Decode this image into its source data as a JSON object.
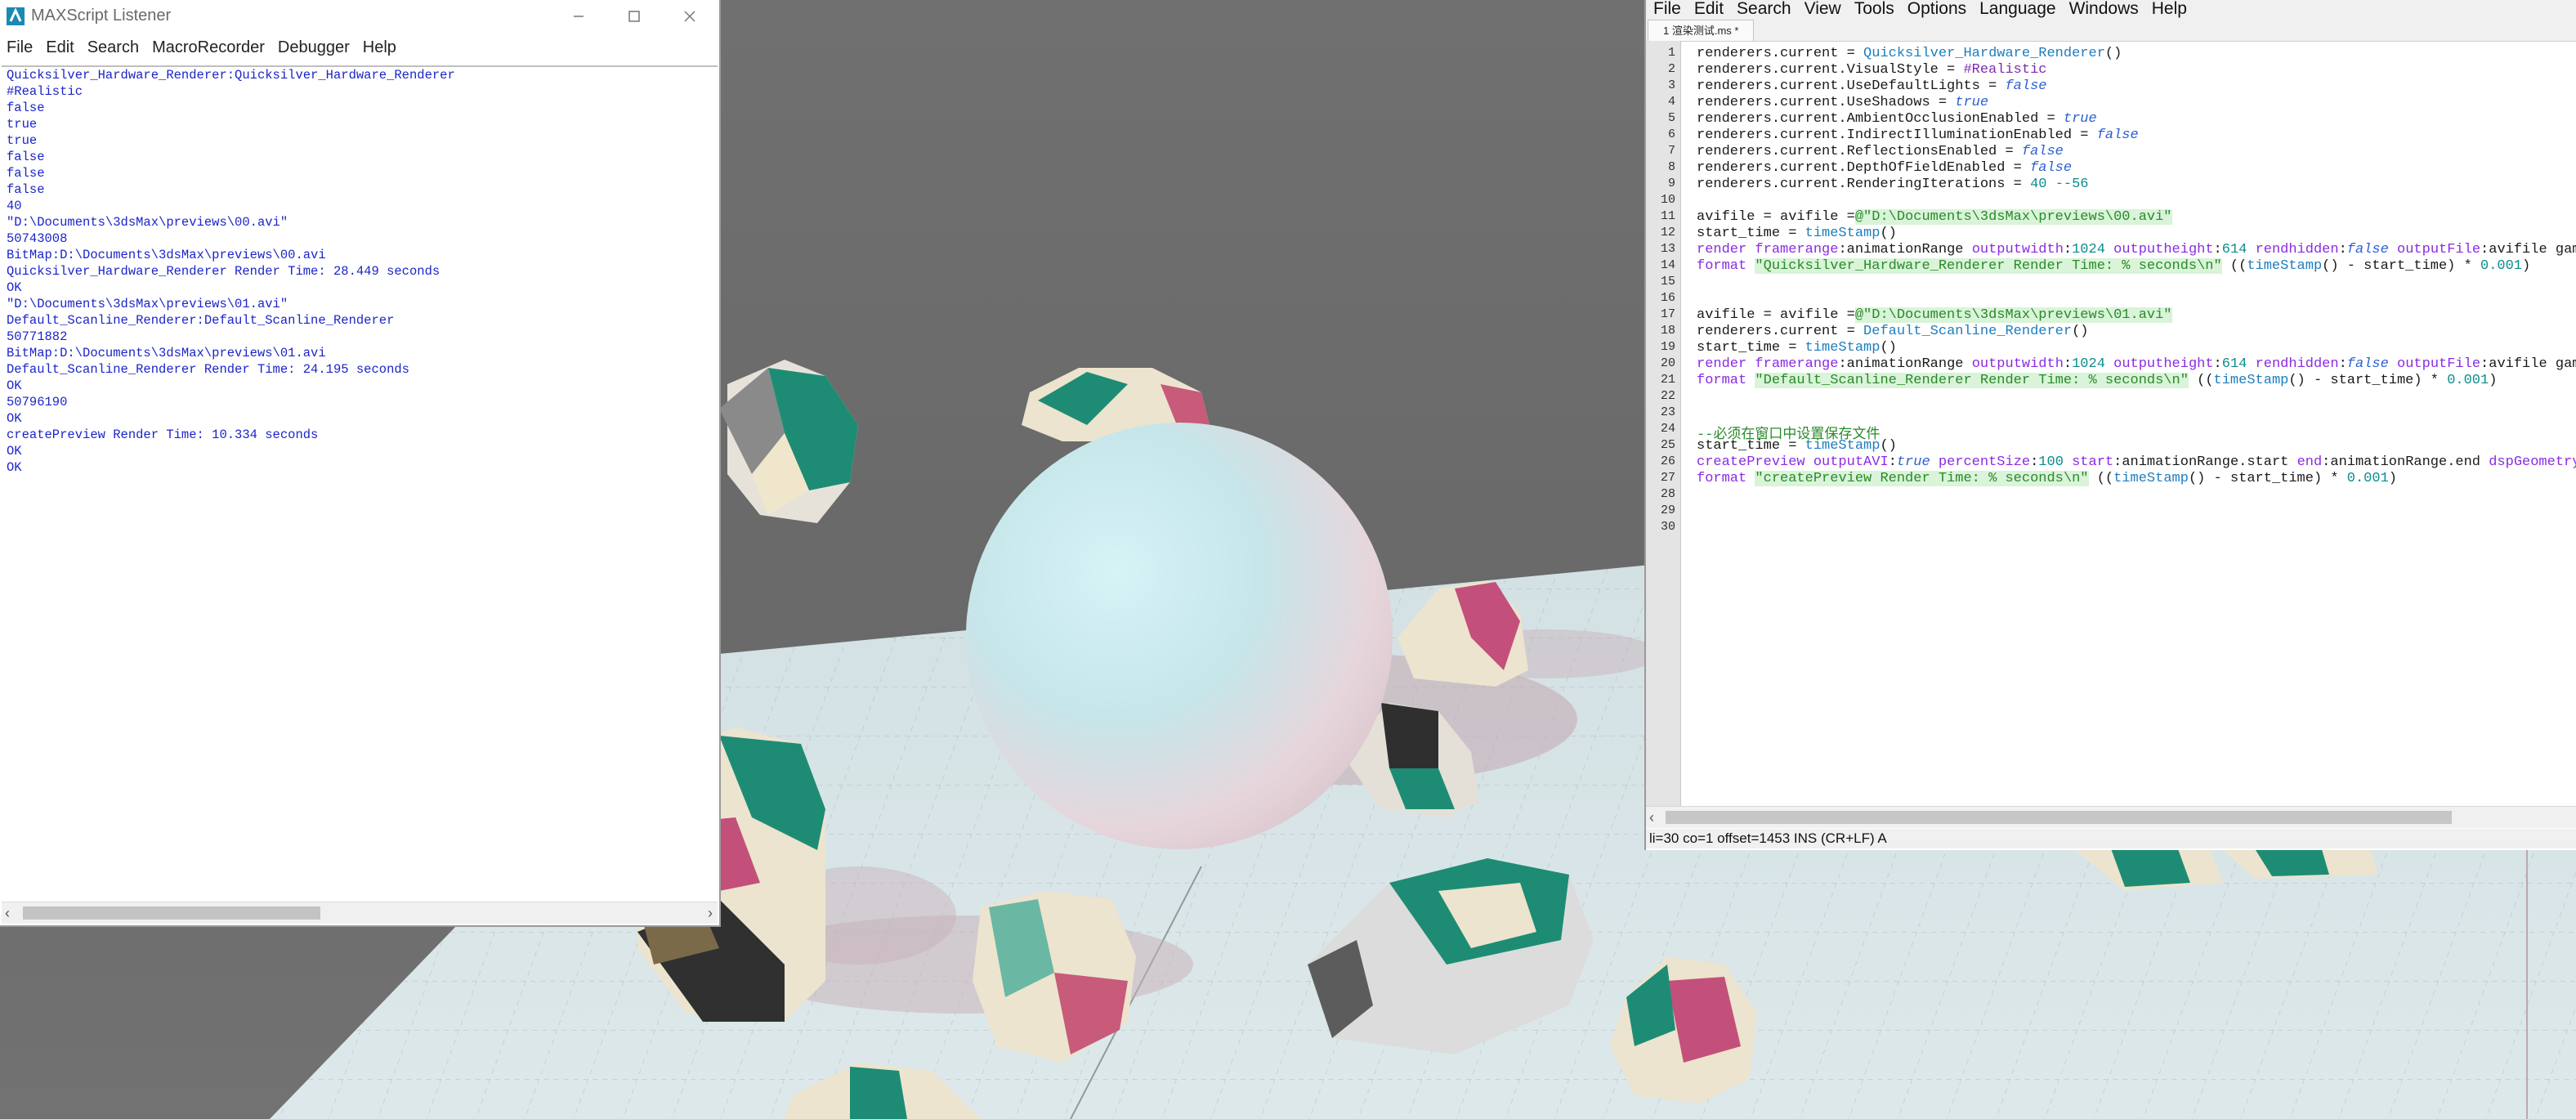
{
  "listener": {
    "title": "MAXScript Listener",
    "menu": [
      "File",
      "Edit",
      "Search",
      "MacroRecorder",
      "Debugger",
      "Help"
    ],
    "output": [
      "Quicksilver_Hardware_Renderer:Quicksilver_Hardware_Renderer",
      "#Realistic",
      "false",
      "true",
      "true",
      "false",
      "false",
      "false",
      "40",
      "\"D:\\Documents\\3dsMax\\previews\\00.avi\"",
      "50743008",
      "BitMap:D:\\Documents\\3dsMax\\previews\\00.avi",
      "Quicksilver_Hardware_Renderer Render Time: 28.449 seconds",
      "OK",
      "\"D:\\Documents\\3dsMax\\previews\\01.avi\"",
      "Default_Scanline_Renderer:Default_Scanline_Renderer",
      "50771882",
      "BitMap:D:\\Documents\\3dsMax\\previews\\01.avi",
      "Default_Scanline_Renderer Render Time: 24.195 seconds",
      "OK",
      "50796190",
      "OK",
      "createPreview Render Time: 10.334 seconds",
      "OK",
      "OK"
    ]
  },
  "editor": {
    "menu": [
      "File",
      "Edit",
      "Search",
      "View",
      "Tools",
      "Options",
      "Language",
      "Windows",
      "Help"
    ],
    "tab_label": "1 渲染测试.ms *",
    "line_numbers": [
      "1",
      "2",
      "3",
      "4",
      "5",
      "6",
      "7",
      "8",
      "9",
      "10",
      "11",
      "12",
      "13",
      "14",
      "15",
      "16",
      "17",
      "18",
      "19",
      "20",
      "21",
      "22",
      "23",
      "24",
      "25",
      "26",
      "27",
      "28",
      "29",
      "30"
    ],
    "code_lines": [
      "renderers.current = Quicksilver_Hardware_Renderer()",
      "renderers.current.VisualStyle = #Realistic",
      "renderers.current.UseDefaultLights = false",
      "renderers.current.UseShadows = true",
      "renderers.current.AmbientOcclusionEnabled = true",
      "renderers.current.IndirectIlluminationEnabled = false",
      "renderers.current.ReflectionsEnabled = false",
      "renderers.current.DepthOfFieldEnabled = false",
      "renderers.current.RenderingIterations = 40 --56",
      "",
      "avifile = avifile =@\"D:\\Documents\\3dsMax\\previews\\00.avi\"",
      "start_time = timeStamp()",
      "render framerange:animationRange outputwidth:1024 outputheight:614 rendhidden:false outputFile:avifile gamma",
      "format \"Quicksilver_Hardware_Renderer Render Time: % seconds\\n\" ((timeStamp() - start_time) * 0.001)",
      "",
      "",
      "avifile = avifile =@\"D:\\Documents\\3dsMax\\previews\\01.avi\"",
      "renderers.current = Default_Scanline_Renderer()",
      "start_time = timeStamp()",
      "render framerange:animationRange outputwidth:1024 outputheight:614 rendhidden:false outputFile:avifile gamma",
      "format \"Default_Scanline_Renderer Render Time: % seconds\\n\" ((timeStamp() - start_time) * 0.001)",
      "",
      "",
      "--必须在窗口中设置保存文件",
      "start_time = timeStamp()",
      "createPreview outputAVI:true percentSize:100 start:animationRange.start end:animationRange.end dspGeometry:t",
      "format \"createPreview Render Time: % seconds\\n\" ((timeStamp() - start_time) * 0.001)",
      "",
      "",
      ""
    ],
    "status": "li=30 co=1 offset=1453 INS (CR+LF) A"
  },
  "colors": {
    "listener_text": "#1b25c8",
    "keyword": "#8a2be2",
    "function": "#1e7dbf",
    "string": "#2a8a2a",
    "number": "#0d8c8c",
    "boolean": "#2b5fd4",
    "viewport_bg": "#6e6e6e",
    "ground": "#dbe6e8"
  }
}
